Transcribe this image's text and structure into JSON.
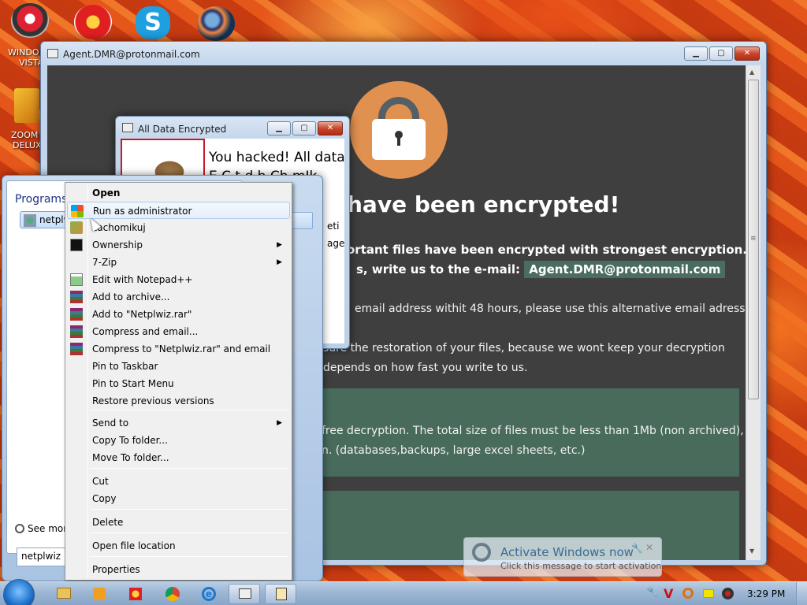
{
  "desktop": {
    "icons": [
      {
        "name": "windows-vista-icon",
        "label_line1": "WINDO",
        "label_line2": "VISTA"
      },
      {
        "name": "zoom-deluxe-icon",
        "label_line1": "ZOOM",
        "label_line2": "DELUX"
      }
    ]
  },
  "ransom_window": {
    "title": "Agent.DMR@protonmail.com",
    "min": "▁",
    "max": "▢",
    "close": "✕",
    "headline": "have been encrypted!",
    "p1_line1": "ortant files have been encrypted with strongest encryption. you",
    "p1_line2_prefix": "s, write us to the e-mail:",
    "p1_email": "Agent.DMR@protonmail.com",
    "p2": "email address withit 48 hours, please use this alternative email adress:",
    "p3_line1": "sure the restoration of your files, because we wont keep your decryption",
    "p3_line2": "depends on how fast you write to us.",
    "p4_line1": "free decryption. The total size of files must be less than 1Mb (non archived),",
    "p4_line2": "n. (databases,backups, large excel sheets, etc.)",
    "scroll_grip": "≡"
  },
  "small_window": {
    "title": "All Data Encrypted",
    "line1": "You hacked! All data",
    "line2": "E  C    t d b  Ch  mIk",
    "frag1": "eti",
    "frag2": "age"
  },
  "start_menu": {
    "programs_label": "Programs",
    "program_item": "netplwiz",
    "see_more": "See more",
    "search_value": "netplwiz"
  },
  "context_menu": {
    "items": [
      {
        "label": "Open",
        "bold": true
      },
      {
        "label": "Run as administrator",
        "highlight": true
      },
      {
        "label": "zachomikuj"
      },
      {
        "label": "Ownership",
        "submenu": true
      },
      {
        "label": "7-Zip",
        "submenu": true
      },
      {
        "label": "Edit with Notepad++"
      },
      {
        "label": "Add to archive..."
      },
      {
        "label": "Add to \"Netplwiz.rar\""
      },
      {
        "label": "Compress and email..."
      },
      {
        "label": "Compress to \"Netplwiz.rar\" and email"
      },
      {
        "label": "Pin to Taskbar"
      },
      {
        "label": "Pin to Start Menu"
      },
      {
        "label": "Restore previous versions"
      },
      {
        "label": "Send to",
        "submenu": true
      },
      {
        "label": "Copy To folder..."
      },
      {
        "label": "Move To folder..."
      },
      {
        "label": "Cut"
      },
      {
        "label": "Copy"
      },
      {
        "label": "Delete"
      },
      {
        "label": "Open file location"
      },
      {
        "label": "Properties"
      }
    ],
    "submenu_arrow": "▶"
  },
  "activation": {
    "title": "Activate Windows now",
    "subtitle": "Click this message to start activation."
  },
  "taskbar": {
    "clock": "3:29 PM"
  },
  "colors": {
    "ransom_bg": "#3f3f3f",
    "panel_green": "#486b5c",
    "lock_orange": "#e0904f"
  }
}
